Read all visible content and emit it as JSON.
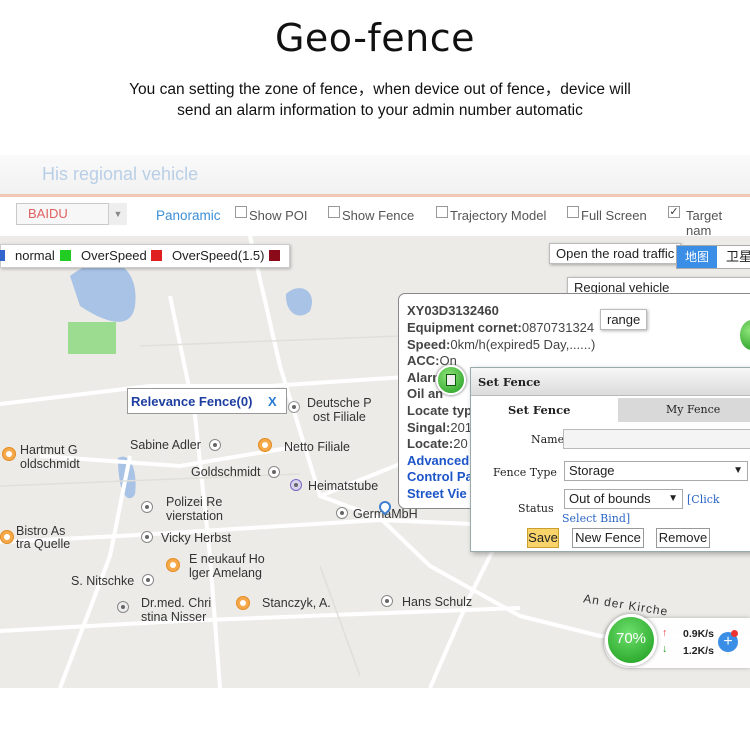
{
  "header": {
    "title": "Geo-fence",
    "subtitle_line1": "You can setting the zone of fence，when device out of fence，device will",
    "subtitle_line2": "send an alarm information to your admin number automatic"
  },
  "app": {
    "heading": "His regional vehicle",
    "map_source": "BAIDU",
    "panoramic": "Panoramic",
    "options": [
      {
        "label": "Show POI",
        "checked": false
      },
      {
        "label": "Show Fence",
        "checked": false
      },
      {
        "label": "Trajectory Model",
        "checked": false
      },
      {
        "label": "Full Screen",
        "checked": false
      },
      {
        "label": "Target nam",
        "checked": true
      }
    ]
  },
  "legend": {
    "normal": "normal",
    "overspeed": "OverSpeed",
    "overspeed_15": "OverSpeed(1.5)",
    "colors": {
      "normal": "#22cc22",
      "overspeed": "#e02020",
      "overspeed_15": "#8b0a1a",
      "first": "#3366cc"
    }
  },
  "map_controls": {
    "open_road_traffic": "Open the road traffic",
    "regional_vehicle": "Regional vehicle",
    "range": "range",
    "map_type_map": "地图",
    "map_type_satellite": "卫星"
  },
  "relevance_fence": {
    "label": "Relevance Fence(0)",
    "close": "X"
  },
  "pois": [
    "Deutsche P",
    "ost Filiale",
    "Hartmut G",
    "oldschmidt",
    "Sabine Adler",
    "Netto Filiale",
    "Goldschmidt",
    "Heimatstube",
    "Polizei Re",
    "vierstation",
    "GermaMbH",
    "Bistro As",
    "tra Quelle",
    "Vicky Herbst",
    "E neukauf Ho",
    "lger Amelang",
    "S. Nitschke",
    "Dr.med. Chri",
    "stina Nisser",
    "Stanczyk, A.",
    "Hans Schulz",
    "An der Kirche"
  ],
  "device_popup": {
    "device_id": "XY03D3132460",
    "equipment_label": "Equipment cornet:",
    "equipment_value": "0870731324",
    "speed_label": "Speed:",
    "speed_value": "0km/h(expired5 Day,......)",
    "acc_label": "ACC:",
    "acc_value": "On",
    "alarm_label": "Alarm",
    "oil_label": "Oil an",
    "locate_type_label": "Locate typ",
    "signal_label": "Singal:",
    "signal_value": "201",
    "locate_label": "Locate:",
    "locate_value": "20",
    "link_advanced": "Advanced",
    "link_control": "Control Pa",
    "link_street": "Street Vie"
  },
  "set_fence": {
    "title": "Set Fence",
    "tab_set": "Set Fence",
    "tab_my": "My Fence",
    "name_label": "Name",
    "name_value": "",
    "fence_type_label": "Fence Type",
    "fence_type_value": "Storage",
    "status_label": "Status",
    "status_value": "Out of bounds",
    "click_text": "[Click",
    "select_bind": "Select Bind]",
    "save": "Save",
    "new_fence": "New Fence",
    "remove": "Remove"
  },
  "speed_widget": {
    "percent": "70%",
    "up_arrow": "↑",
    "down_arrow": "↓",
    "upload": "0.9K/s",
    "download": "1.2K/s",
    "plus": "+"
  }
}
